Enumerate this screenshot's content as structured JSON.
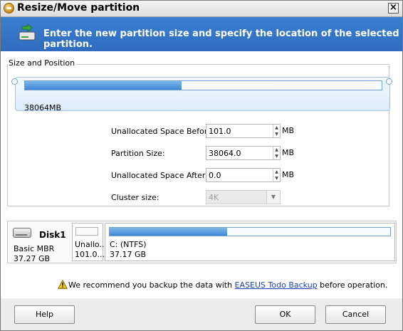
{
  "window": {
    "title": "Resize/Move partition"
  },
  "header": {
    "instruction": "Enter the new partition size and specify the location of the selected partition."
  },
  "size_position": {
    "legend": "Size and Position",
    "partition_bar_label": "38064MB",
    "partition_fill_percent": 44,
    "fields": [
      {
        "label": "Unallocated Space Before:",
        "value": "101.0",
        "unit": "MB"
      },
      {
        "label": "Partition Size:",
        "value": "38064.0",
        "unit": "MB"
      },
      {
        "label": "Unallocated Space After:",
        "value": "0.0",
        "unit": "MB"
      }
    ],
    "cluster": {
      "label": "Cluster size:",
      "value": "4K"
    }
  },
  "disk_map": {
    "disk_name": "Disk1",
    "disk_type": "Basic MBR",
    "disk_size": "37.27 GB",
    "unallocated": {
      "label": "Unallo...",
      "size": "101.0..."
    },
    "partition": {
      "label": "C: (NTFS)",
      "size": "37.17 GB",
      "fill_percent": 42
    }
  },
  "warning": {
    "before": "We recommend you backup the data with ",
    "link": "EASEUS Todo Backup",
    "after": " before operation."
  },
  "buttons": {
    "help": "Help",
    "ok": "OK",
    "cancel": "Cancel"
  },
  "icons": {
    "title": "app-icon",
    "header": "disk-resize-icon",
    "warning": "warning-icon",
    "close": "close-icon"
  },
  "colors": {
    "header_bg": "#2f6cc0",
    "partition_fill": "#3e88d6",
    "link": "#1a3fb5"
  }
}
